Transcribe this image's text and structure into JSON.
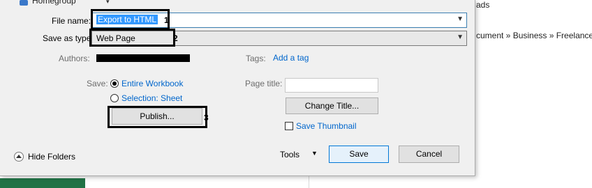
{
  "background": {
    "ads_text": "ads",
    "breadcrumb": "cument » Business » Freelance »"
  },
  "nav": {
    "homegroup_label": "Homegroup"
  },
  "form": {
    "file_name_label": "File name:",
    "file_name_value": "Export to HTML",
    "save_as_type_label": "Save as type:",
    "save_as_type_value": "Web Page",
    "authors_label": "Authors:",
    "tags_label": "Tags:",
    "add_tag_link": "Add a tag",
    "save_label": "Save:",
    "radio_entire": "Entire Workbook",
    "radio_selection": "Selection: Sheet",
    "page_title_label": "Page title:",
    "page_title_value": "",
    "change_title_button": "Change Title...",
    "publish_button": "Publish...",
    "save_thumbnail_label": "Save Thumbnail",
    "save_thumbnail_checked": false,
    "entire_workbook_selected": true
  },
  "callouts": {
    "one": "1",
    "two": "2",
    "three": "3"
  },
  "footer": {
    "hide_folders": "Hide Folders",
    "tools": "Tools",
    "save_button": "Save",
    "cancel_button": "Cancel"
  },
  "icons": {
    "homegroup": "homegroup-icon",
    "dropdown": "chevron-down-icon",
    "hide_folders": "chevron-up-circle-icon"
  }
}
